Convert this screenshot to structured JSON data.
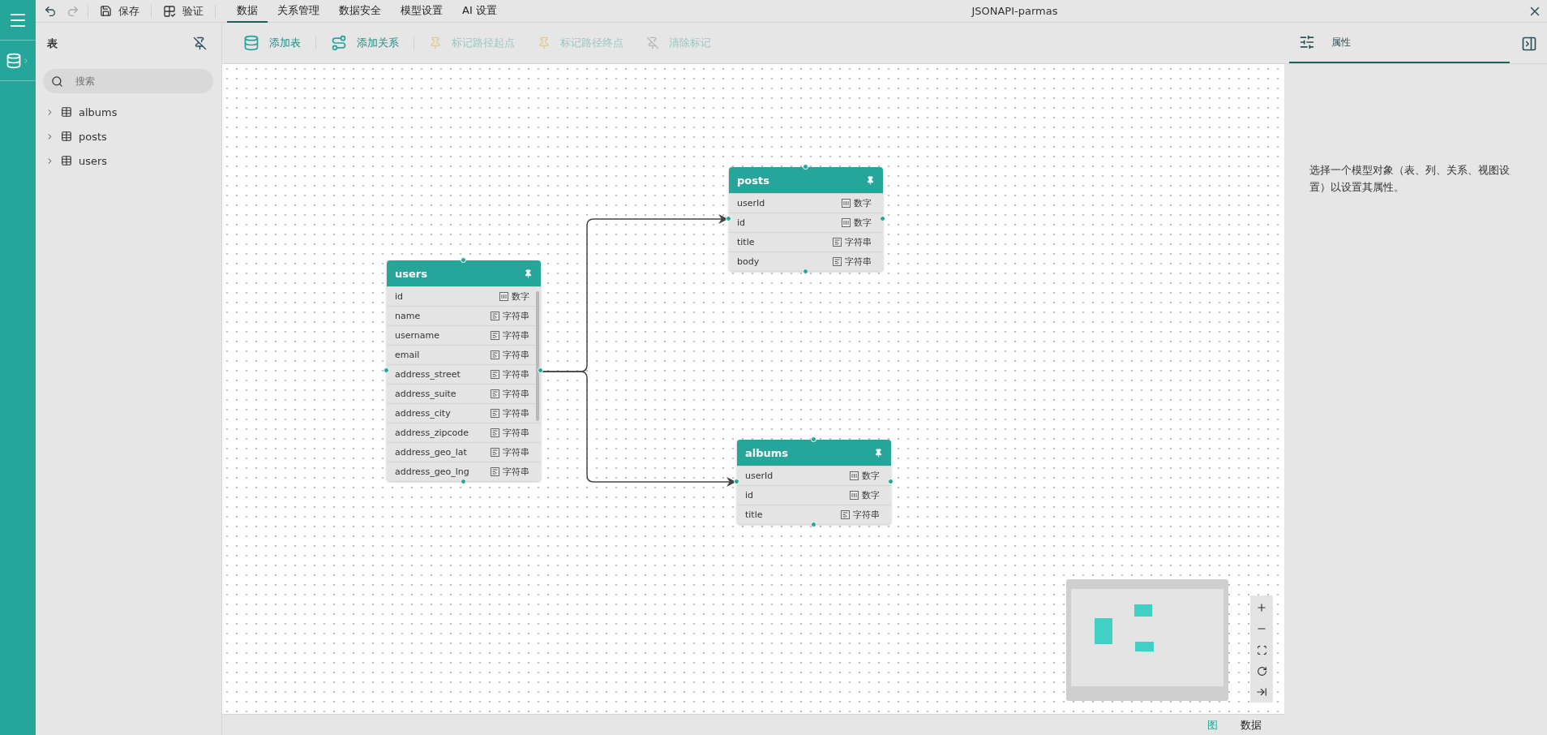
{
  "menu_bar": {
    "actions": [
      {
        "kind": "undo",
        "disabled": false
      },
      {
        "kind": "redo",
        "disabled": true
      },
      {
        "kind": "save",
        "label": "保存",
        "disabled": false
      },
      {
        "kind": "validate",
        "label": "验证",
        "disabled": false
      }
    ],
    "tabs": [
      {
        "label": "数据",
        "selected": true
      },
      {
        "label": "关系管理",
        "selected": false
      },
      {
        "label": "数据安全",
        "selected": false
      },
      {
        "label": "模型设置",
        "selected": false
      },
      {
        "label": "AI 设置",
        "selected": false
      }
    ],
    "title": "JSONAPI-parmas"
  },
  "sidebar": {
    "title": "表",
    "search": {
      "placeholder": "搜索"
    },
    "items": [
      {
        "label": "albums",
        "expanded": false
      },
      {
        "label": "posts",
        "expanded": false
      },
      {
        "label": "users",
        "expanded": false
      }
    ]
  },
  "toolbar": {
    "buttons": [
      {
        "kind": "add-table",
        "label": "添加表",
        "disabled": false
      },
      {
        "kind": "add-relation",
        "label": "添加关系",
        "disabled": false
      },
      {
        "kind": "mark-start",
        "label": "标记路径起点",
        "disabled": true
      },
      {
        "kind": "mark-end",
        "label": "标记路径终点",
        "disabled": true
      },
      {
        "kind": "clear-marks",
        "label": "清除标记",
        "disabled": true
      }
    ]
  },
  "canvas": {
    "tables": [
      {
        "name": "users",
        "columns": [
          {
            "name": "id",
            "type": "数字",
            "kind": "number"
          },
          {
            "name": "name",
            "type": "字符串",
            "kind": "string"
          },
          {
            "name": "username",
            "type": "字符串",
            "kind": "string"
          },
          {
            "name": "email",
            "type": "字符串",
            "kind": "string"
          },
          {
            "name": "address_street",
            "type": "字符串",
            "kind": "string"
          },
          {
            "name": "address_suite",
            "type": "字符串",
            "kind": "string"
          },
          {
            "name": "address_city",
            "type": "字符串",
            "kind": "string"
          },
          {
            "name": "address_zipcode",
            "type": "字符串",
            "kind": "string"
          },
          {
            "name": "address_geo_lat",
            "type": "字符串",
            "kind": "string"
          },
          {
            "name": "address_geo_lng",
            "type": "字符串",
            "kind": "string"
          }
        ]
      },
      {
        "name": "posts",
        "columns": [
          {
            "name": "userId",
            "type": "数字",
            "kind": "number"
          },
          {
            "name": "id",
            "type": "数字",
            "kind": "number"
          },
          {
            "name": "title",
            "type": "字符串",
            "kind": "string"
          },
          {
            "name": "body",
            "type": "字符串",
            "kind": "string"
          }
        ]
      },
      {
        "name": "albums",
        "columns": [
          {
            "name": "userId",
            "type": "数字",
            "kind": "number"
          },
          {
            "name": "id",
            "type": "数字",
            "kind": "number"
          },
          {
            "name": "title",
            "type": "字符串",
            "kind": "string"
          }
        ]
      }
    ]
  },
  "bottom_tabs": [
    {
      "label": "图",
      "selected": true
    },
    {
      "label": "数据",
      "selected": false
    }
  ],
  "properties_panel": {
    "tab": {
      "label": "属性",
      "selected": true
    },
    "hint": "选择一个模型对象（表、列、关系、视图设置）以设置其属性。"
  }
}
